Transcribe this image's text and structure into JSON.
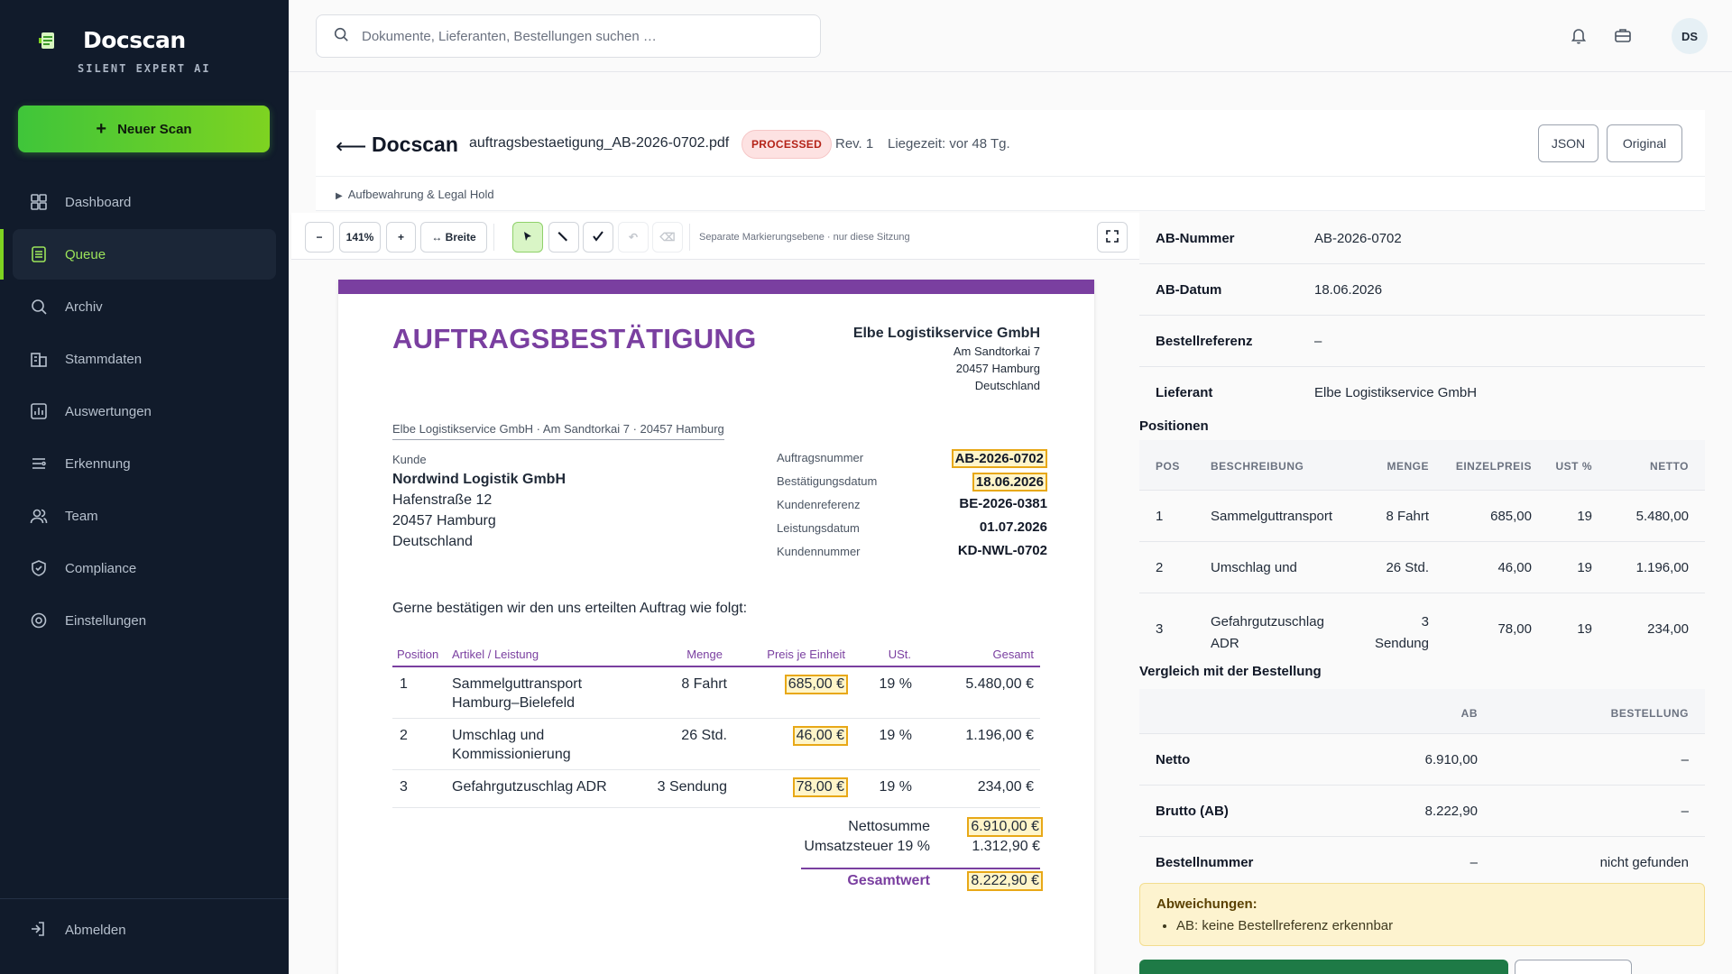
{
  "sidebar": {
    "brand_title": "Docscan",
    "brand_subtitle": "SILENT EXPERT AI",
    "new_scan_label": "Neuer Scan",
    "items": [
      {
        "label": "Dashboard",
        "icon": "grid-icon"
      },
      {
        "label": "Queue",
        "icon": "list-icon",
        "active": true
      },
      {
        "label": "Archiv",
        "icon": "search-icon"
      },
      {
        "label": "Stammdaten",
        "icon": "building-icon"
      },
      {
        "label": "Auswertungen",
        "icon": "chart-icon"
      },
      {
        "label": "Erkennung",
        "icon": "scan-icon"
      },
      {
        "label": "Team",
        "icon": "users-icon"
      },
      {
        "label": "Compliance",
        "icon": "shield-icon"
      },
      {
        "label": "Einstellungen",
        "icon": "gear-icon"
      }
    ],
    "logout_label": "Abmelden"
  },
  "topbar": {
    "search_placeholder": "Dokumente, Lieferanten, Bestellungen suchen …",
    "avatar_initials": "DS"
  },
  "doc_header": {
    "title": "Docscan",
    "filename": "auftragsbestaetigung_AB-2026-0702.pdf",
    "status": "PROCESSED",
    "revision": "Rev. 1",
    "liegezeit": "Liegezeit: vor 48 Tg.",
    "json_button": "JSON",
    "original_button": "Original"
  },
  "legal_hold_label": "Aufbewahrung & Legal Hold",
  "toolbar": {
    "zoom_out": "−",
    "zoom_level": "141%",
    "zoom_in": "+",
    "fit_width": "↔ Breite",
    "note": "Separate Markierungsebene · nur diese Sitzung"
  },
  "document": {
    "heading": "AUFTRAGSBESTÄTIGUNG",
    "sender_name": "Elbe Logistikservice GmbH",
    "sender_street": "Am Sandtorkai 7",
    "sender_city": "20457 Hamburg",
    "sender_country": "Deutschland",
    "sender_line": "Elbe Logistikservice GmbH · Am Sandtorkai 7 · 20457 Hamburg",
    "customer_label": "Kunde",
    "customer_name": "Nordwind Logistik GmbH",
    "customer_street": "Hafenstraße 12",
    "customer_city": "20457 Hamburg",
    "customer_country": "Deutschland",
    "meta": [
      {
        "label": "Auftragsnummer",
        "value": "AB-2026-0702",
        "highlight": true
      },
      {
        "label": "Bestätigungsdatum",
        "value": "18.06.2026",
        "highlight": true
      },
      {
        "label": "Kundenreferenz",
        "value": "BE-2026-0381",
        "highlight": false
      },
      {
        "label": "Leistungsdatum",
        "value": "01.07.2026",
        "highlight": false
      },
      {
        "label": "Kundennummer",
        "value": "KD-NWL-0702",
        "highlight": false
      }
    ],
    "intro": "Gerne bestätigen wir den uns erteilten Auftrag wie folgt:",
    "items_header": {
      "position": "Position",
      "article": "Artikel / Leistung",
      "qty": "Menge",
      "price": "Preis je Einheit",
      "vat": "USt.",
      "total": "Gesamt"
    },
    "items": [
      {
        "pos": "1",
        "desc1": "Sammelguttransport",
        "desc2": "Hamburg–Bielefeld",
        "qty": "8 Fahrt",
        "price": "685,00 €",
        "vat": "19 %",
        "total": "5.480,00 €"
      },
      {
        "pos": "2",
        "desc1": "Umschlag und",
        "desc2": "Kommissionierung",
        "qty": "26 Std.",
        "price": "46,00 €",
        "vat": "19 %",
        "total": "1.196,00 €"
      },
      {
        "pos": "3",
        "desc1": "Gefahrgutzuschlag ADR",
        "desc2": "",
        "qty": "3 Sendung",
        "price": "78,00 €",
        "vat": "19 %",
        "total": "234,00 €"
      }
    ],
    "net_label": "Nettosumme",
    "net_value": "6.910,00 €",
    "vat_label": "Umsatzsteuer 19 %",
    "vat_value": "1.312,90 €",
    "grand_label": "Gesamtwert",
    "grand_value": "8.222,90 €"
  },
  "fields": [
    {
      "label": "AB-Nummer",
      "value": "AB-2026-0702"
    },
    {
      "label": "AB-Datum",
      "value": "18.06.2026"
    },
    {
      "label": "Bestellreferenz",
      "value": "–"
    },
    {
      "label": "Lieferant",
      "value": "Elbe Logistikservice GmbH"
    }
  ],
  "positions": {
    "title": "Positionen",
    "header": {
      "pos": "POS",
      "desc": "BESCHREIBUNG",
      "qty": "MENGE",
      "unit": "EINZELPREIS",
      "vat": "UST %",
      "net": "NETTO"
    },
    "rows": [
      {
        "pos": "1",
        "desc1": "Sammelguttransport",
        "desc2": "",
        "qty1": "8 Fahrt",
        "qty2": "",
        "unit": "685,00",
        "vat": "19",
        "net": "5.480,00"
      },
      {
        "pos": "2",
        "desc1": "Umschlag und",
        "desc2": "",
        "qty1": "26 Std.",
        "qty2": "",
        "unit": "46,00",
        "vat": "19",
        "net": "1.196,00"
      },
      {
        "pos": "3",
        "desc1": "Gefahrgutzuschlag",
        "desc2": "ADR",
        "qty1": "3",
        "qty2": "Sendung",
        "unit": "78,00",
        "vat": "19",
        "net": "234,00"
      }
    ]
  },
  "comparison": {
    "title": "Vergleich mit der Bestellung",
    "col_ab": "AB",
    "col_order": "BESTELLUNG",
    "rows": [
      {
        "label": "Netto",
        "ab": "6.910,00",
        "order": "–"
      },
      {
        "label": "Brutto (AB)",
        "ab": "8.222,90",
        "order": "–"
      },
      {
        "label": "Bestellnummer",
        "ab": "–",
        "order": "nicht gefunden"
      }
    ]
  },
  "alert": {
    "title": "Abweichungen:",
    "item": "AB: keine Bestellreferenz erkennbar"
  },
  "colors": {
    "sidebar_bg": "#111b2b",
    "accent_green": "#7ed321",
    "document_purple": "#7a3fa0",
    "highlight": "#e8a817",
    "status_red": "#b42318"
  }
}
